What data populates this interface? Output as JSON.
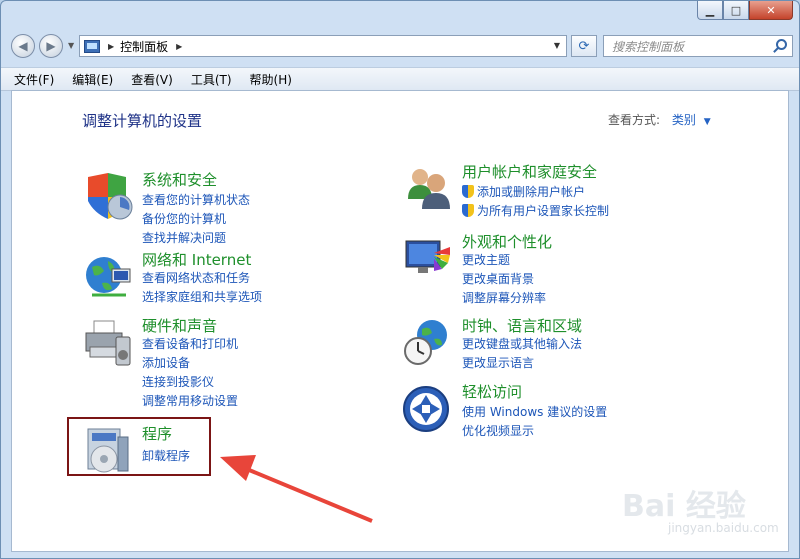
{
  "window": {
    "controls": {
      "minimize": "▁",
      "maximize": "□",
      "close": "✕"
    }
  },
  "nav": {
    "back_icon": "back-arrow-icon",
    "forward_icon": "forward-arrow-icon",
    "breadcrumb": [
      "控制面板"
    ],
    "search_placeholder": "搜索控制面板"
  },
  "menu": [
    "文件(F)",
    "编辑(E)",
    "查看(V)",
    "工具(T)",
    "帮助(H)"
  ],
  "header": {
    "title": "调整计算机的设置",
    "view_by_label": "查看方式:",
    "view_by_value": "类别"
  },
  "categories": [
    {
      "title": "系统和安全",
      "links": [
        "查看您的计算机状态",
        "备份您的计算机",
        "查找并解决问题"
      ],
      "icon": "shield-pc-icon"
    },
    {
      "title": "网络和 Internet",
      "links": [
        "查看网络状态和任务",
        "选择家庭组和共享选项"
      ],
      "icon": "globe-network-icon"
    },
    {
      "title": "硬件和声音",
      "links": [
        "查看设备和打印机",
        "添加设备",
        "连接到投影仪",
        "调整常用移动设置"
      ],
      "icon": "printer-icon"
    },
    {
      "title": "程序",
      "links": [
        "卸载程序"
      ],
      "icon": "programs-disc-icon"
    },
    {
      "title": "用户帐户和家庭安全",
      "links": [
        "添加或删除用户帐户",
        "为所有用户设置家长控制"
      ],
      "icon": "users-icon",
      "shield_links": true
    },
    {
      "title": "外观和个性化",
      "links": [
        "更改主题",
        "更改桌面背景",
        "调整屏幕分辨率"
      ],
      "icon": "monitor-palette-icon"
    },
    {
      "title": "时钟、语言和区域",
      "links": [
        "更改键盘或其他输入法",
        "更改显示语言"
      ],
      "icon": "clock-globe-icon"
    },
    {
      "title": "轻松访问",
      "links": [
        "使用 Windows 建议的设置",
        "优化视频显示"
      ],
      "icon": "ease-of-access-icon"
    }
  ],
  "watermark": {
    "text": "Bai 经验",
    "sub": "jingyan.baidu.com"
  },
  "colors": {
    "category_title": "#1e8f2b",
    "link": "#1d56b8",
    "annotation": "#7b1515",
    "arrow": "#e8453a"
  }
}
